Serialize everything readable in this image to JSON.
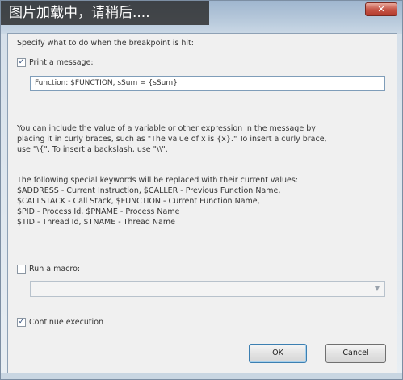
{
  "overlay": {
    "loading_text": "图片加载中，请稍后...."
  },
  "window": {
    "close_glyph": "✕"
  },
  "dialog": {
    "intro": "Specify what to do when the breakpoint is hit:",
    "print_message": {
      "label": "Print a message:",
      "checked": true,
      "value": "Function: $FUNCTION, sSum = {sSum}"
    },
    "help_lines": [
      "You can include the value of a variable or other expression in the message by",
      "placing it in curly braces, such as \"The value of x is {x}.\" To insert a curly brace,",
      "use \"\\{\". To insert a backslash, use \"\\\\\"."
    ],
    "keywords_intro": "The following special keywords will be replaced with their current values:",
    "keywords": [
      "$ADDRESS - Current Instruction, $CALLER - Previous Function Name,",
      "$CALLSTACK - Call Stack, $FUNCTION - Current Function Name,",
      "$PID - Process Id, $PNAME - Process Name",
      "$TID - Thread Id, $TNAME - Thread Name"
    ],
    "run_macro": {
      "label": "Run a macro:",
      "checked": false,
      "value": ""
    },
    "continue_execution": {
      "label": "Continue execution",
      "checked": true
    },
    "buttons": {
      "ok": "OK",
      "cancel": "Cancel"
    }
  },
  "colors": {
    "overlay_bg": "#282828",
    "close_button": "#c8584a",
    "default_button_border": "#3c7fb1"
  }
}
